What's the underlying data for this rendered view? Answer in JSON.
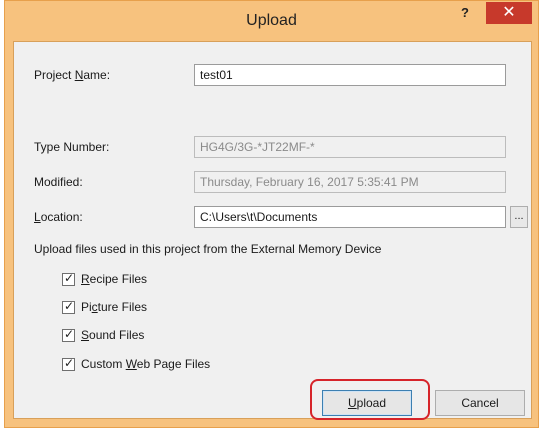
{
  "window": {
    "title": "Upload",
    "help_label": "?",
    "close_label": "✕"
  },
  "project_name": {
    "label_pre": "Project ",
    "label_accel": "N",
    "label_post": "ame:",
    "value": "test01"
  },
  "type_number": {
    "label": "Type Number:",
    "value": "HG4G/3G-*JT22MF-*"
  },
  "modified": {
    "label": "Modified:",
    "value": "Thursday, February 16, 2017 5:35:41 PM"
  },
  "location": {
    "label_accel": "L",
    "label_post": "ocation:",
    "value": "C:\\Users\\t\\Documents",
    "browse_label": "..."
  },
  "upload_group": {
    "caption": "Upload files used in this project from the External Memory Device",
    "checkboxes": [
      {
        "pre": "",
        "accel": "R",
        "post": "ecipe Files",
        "checked": true
      },
      {
        "pre": "Pi",
        "accel": "c",
        "post": "ture Files",
        "checked": true
      },
      {
        "pre": "",
        "accel": "S",
        "post": "ound Files",
        "checked": true
      },
      {
        "pre": "Custom ",
        "accel": "W",
        "post": "eb Page Files",
        "checked": true
      }
    ]
  },
  "buttons": {
    "upload": {
      "accel": "U",
      "post": "pload"
    },
    "cancel": "Cancel"
  },
  "colors": {
    "accent_highlight": "#d6242a",
    "titlebar": "#f7c27e",
    "close": "#c7392b"
  }
}
